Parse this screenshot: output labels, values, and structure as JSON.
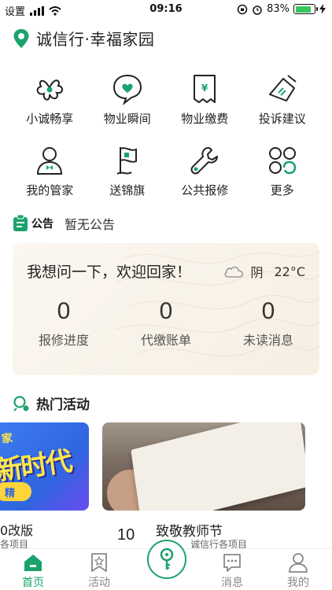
{
  "status_bar": {
    "carrier": "设置",
    "time": "09:16",
    "battery_percent": "83%",
    "battery_level": 0.83,
    "icons": [
      "signal-icon",
      "wifi-icon",
      "orientation-lock-icon",
      "alarm-icon",
      "battery-icon",
      "charging-icon"
    ]
  },
  "header": {
    "location_icon": "location-pin-icon",
    "title": "诚信行·幸福家园"
  },
  "services": [
    {
      "label": "小诚畅享",
      "icon": "clover-share-icon"
    },
    {
      "label": "物业瞬间",
      "icon": "heart-bubble-icon"
    },
    {
      "label": "物业缴费",
      "icon": "payment-bill-icon"
    },
    {
      "label": "投诉建议",
      "icon": "feedback-pen-icon"
    },
    {
      "label": "我的管家",
      "icon": "butler-icon"
    },
    {
      "label": "送锦旗",
      "icon": "banner-flag-icon"
    },
    {
      "label": "公共报修",
      "icon": "wrench-icon"
    },
    {
      "label": "更多",
      "icon": "more-grid-icon"
    }
  ],
  "notice": {
    "tag": "公告",
    "text": "暂无公告"
  },
  "welcome_card": {
    "greeting": "我想问一下，欢迎回家！",
    "weather_condition": "阴",
    "temperature": "22°C",
    "stats": [
      {
        "value": "0",
        "label": "报修进度"
      },
      {
        "value": "0",
        "label": "代缴账单"
      },
      {
        "value": "0",
        "label": "未读消息"
      }
    ]
  },
  "activities": {
    "title": "热门活动",
    "left_card": {
      "banner_big": "新时代",
      "banner_small": "家",
      "banner_pill": "精",
      "caption": "0改版",
      "subcaption": "各项目"
    },
    "main_card": {
      "date": "10",
      "caption": "致敬教师节",
      "subcaption": "诚信行各项目"
    }
  },
  "tabbar": {
    "items": [
      {
        "label": "首页",
        "icon": "home-icon",
        "active": true
      },
      {
        "label": "活动",
        "icon": "activity-bookmark-icon",
        "active": false
      },
      {
        "label": "",
        "icon": "key-icon",
        "active": false
      },
      {
        "label": "消息",
        "icon": "message-icon",
        "active": false
      },
      {
        "label": "我的",
        "icon": "profile-icon",
        "active": false
      }
    ]
  },
  "colors": {
    "accent": "#1aa36a",
    "card_bg": "#f6efe3",
    "text": "#222222"
  }
}
